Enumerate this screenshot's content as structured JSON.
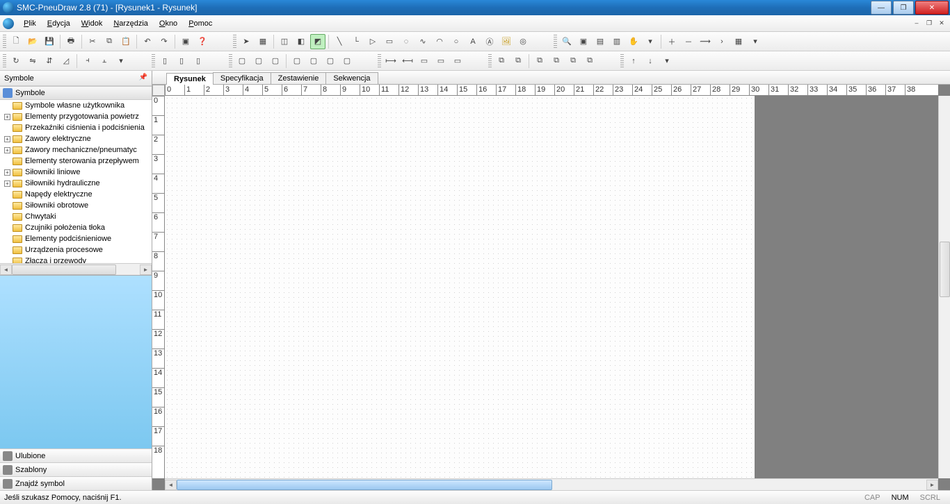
{
  "title": "SMC-PneuDraw 2.8 (71) - [Rysunek1 - Rysunek]",
  "menus": [
    "Plik",
    "Edycja",
    "Widok",
    "Narzędzia",
    "Okno",
    "Pomoc"
  ],
  "sidebar": {
    "title": "Symbole",
    "header": "Symbole",
    "items": [
      {
        "label": "Symbole własne użytkownika",
        "expand": ""
      },
      {
        "label": "Elementy przygotowania powietrz",
        "expand": "+"
      },
      {
        "label": "Przekaźniki ciśnienia i podciśnienia",
        "expand": ""
      },
      {
        "label": "Zawory elektryczne",
        "expand": "+"
      },
      {
        "label": "Zawory mechaniczne/pneumatyc",
        "expand": "+"
      },
      {
        "label": "Elementy sterowania przepływem",
        "expand": ""
      },
      {
        "label": "Siłowniki liniowe",
        "expand": "+"
      },
      {
        "label": "Siłowniki hydrauliczne",
        "expand": "+"
      },
      {
        "label": "Napędy elektryczne",
        "expand": ""
      },
      {
        "label": "Siłowniki obrotowe",
        "expand": ""
      },
      {
        "label": "Chwytaki",
        "expand": ""
      },
      {
        "label": "Czujniki położenia tłoka",
        "expand": ""
      },
      {
        "label": "Elementy podciśnieniowe",
        "expand": ""
      },
      {
        "label": "Urządzenia procesowe",
        "expand": ""
      },
      {
        "label": "Złącza i przewody",
        "expand": ""
      }
    ],
    "bottom": [
      "Ulubione",
      "Szablony",
      "Znajdź symbol"
    ]
  },
  "tabs": [
    "Rysunek",
    "Specyfikacja",
    "Zestawienie",
    "Sekwencja"
  ],
  "hruler": [
    "0",
    "1",
    "2",
    "3",
    "4",
    "5",
    "6",
    "7",
    "8",
    "9",
    "10",
    "11",
    "12",
    "13",
    "14",
    "15",
    "16",
    "17",
    "18",
    "19",
    "20",
    "21",
    "22",
    "23",
    "24",
    "25",
    "26",
    "27",
    "28",
    "29",
    "30",
    "31",
    "32",
    "33",
    "34",
    "35",
    "36",
    "37",
    "38"
  ],
  "vruler": [
    "0",
    "1",
    "2",
    "3",
    "4",
    "5",
    "6",
    "7",
    "8",
    "9",
    "10",
    "11",
    "12",
    "13",
    "14",
    "15",
    "16",
    "17",
    "18"
  ],
  "status": {
    "hint": "Jeśli szukasz Pomocy, naciśnij F1.",
    "cap": "CAP",
    "num": "NUM",
    "scrl": "SCRL"
  }
}
